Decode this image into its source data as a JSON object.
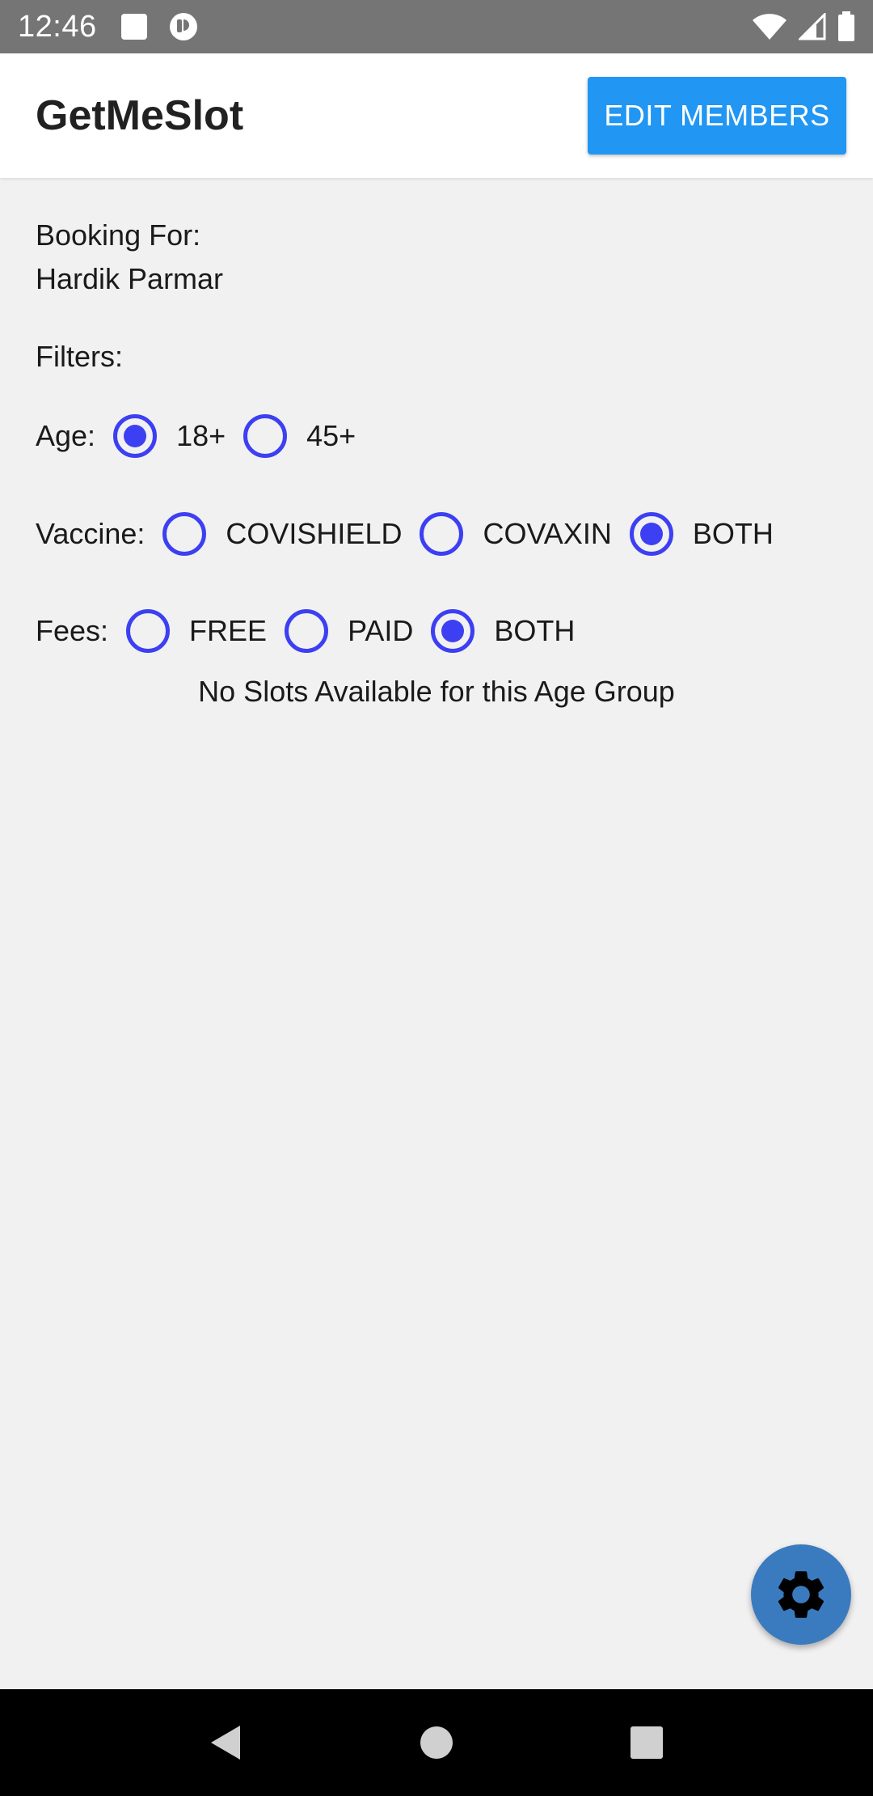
{
  "status_bar": {
    "time": "12:46"
  },
  "app_bar": {
    "title": "GetMeSlot",
    "edit_button_label": "EDIT MEMBERS",
    "accent": "#2196f3"
  },
  "booking": {
    "label": "Booking For:",
    "member_name": "Hardik Parmar"
  },
  "filters": {
    "heading": "Filters:",
    "radio_color": "#3d3ff2",
    "age": {
      "label": "Age:",
      "options": [
        {
          "label": "18+",
          "selected": true
        },
        {
          "label": "45+",
          "selected": false
        }
      ]
    },
    "vaccine": {
      "label": "Vaccine:",
      "options": [
        {
          "label": "COVISHIELD",
          "selected": false
        },
        {
          "label": "COVAXIN",
          "selected": false
        },
        {
          "label": "BOTH",
          "selected": true
        }
      ]
    },
    "fees": {
      "label": "Fees:",
      "options": [
        {
          "label": "FREE",
          "selected": false
        },
        {
          "label": "PAID",
          "selected": false
        },
        {
          "label": "BOTH",
          "selected": true
        }
      ]
    }
  },
  "empty_message": "No Slots Available for this Age Group",
  "fab": {
    "icon": "gear-icon",
    "color": "#3a7bbf"
  },
  "nav_bar": {
    "icons": [
      "back-icon",
      "home-icon",
      "recents-icon"
    ]
  }
}
